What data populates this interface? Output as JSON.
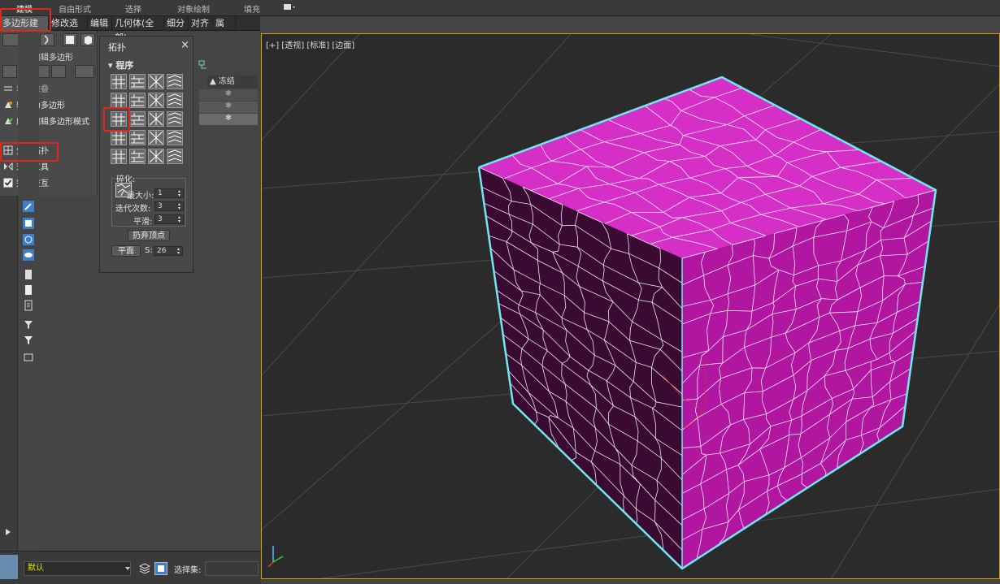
{
  "ribbon_tabs": [
    "建模",
    "自由形式",
    "选择",
    "对象绘制",
    "填充"
  ],
  "sub_tabs": [
    "多边形建模",
    "修改选择",
    "编辑",
    "几何体(全部)",
    "细分",
    "对齐",
    "属性"
  ],
  "ribbon_panel": {
    "title": "可编辑多边形",
    "commands": [
      "塌陷堆叠",
      "转化为多边形",
      "应用编辑多边形模式",
      "生成拓扑",
      "对称工具",
      "完全交互"
    ]
  },
  "topology_panel": {
    "title": "拓扑",
    "close": "×",
    "section": "程序",
    "group_label": "碎化:",
    "max_size_label": "最大小:",
    "max_size_value": "1",
    "iterations_label": "迭代次数:",
    "iterations_value": "3",
    "smooth_label": "平滑:",
    "smooth_value": "3",
    "discard_button": "扔弃顶点",
    "plane_button": "平面",
    "s_label": "S:",
    "s_value": "26"
  },
  "explorer": {
    "freeze_header": "冻结",
    "freeze_icon": "snowflake-icon"
  },
  "viewport": {
    "label": "[+] [透视] [标准] [边面]"
  },
  "bottom_bar": {
    "layer": "默认",
    "selection_set_label": "选择集:"
  },
  "colors": {
    "cube_top": "#d62fc7",
    "cube_right": "#b0169f",
    "cube_left": "#3a0a32",
    "selection_outline": "#6fe8f0",
    "highlight": "#e0261d",
    "viewport_border": "#d8a000"
  }
}
